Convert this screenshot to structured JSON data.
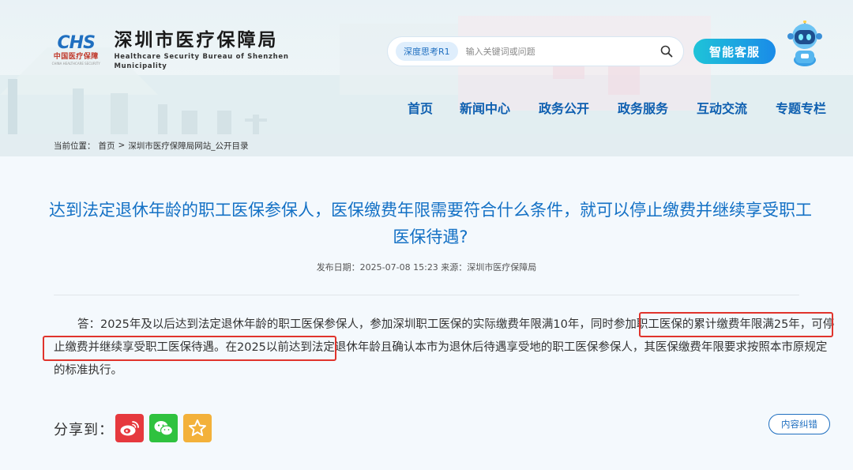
{
  "header": {
    "logo_mark": "CHS",
    "logo_mark_cn": "中国医疗保障",
    "logo_mark_en": "CHINA HEALTHCARE SECURITY",
    "title_cn": "深圳市医疗保障局",
    "title_en": "Healthcare Security Bureau of Shenzhen Municipality"
  },
  "search": {
    "tag": "深度思考R1",
    "placeholder": "输入关键词或问题"
  },
  "service_button": "智能客服",
  "nav": [
    "首页",
    "新闻中心",
    "政务公开",
    "政务服务",
    "互动交流",
    "专题专栏"
  ],
  "breadcrumb": {
    "label": "当前位置：",
    "home": "首页",
    "sep": ">",
    "current": "深圳市医疗保障局网站_公开目录"
  },
  "article": {
    "title": "达到法定退休年龄的职工医保参保人，医保缴费年限需要符合什么条件，就可以停止缴费并继续享受职工医保待遇?",
    "meta": "发布日期：2025-07-08 15:23 来源：深圳市医疗保障局",
    "body_part1": "答：2025年及以后达到法定退休年龄的职工医保参保人，参加深圳职工医保的实际缴费年限满10年，",
    "body_highlight": "同时参加职工医保的累计缴费年限满25年，可停止缴费并继续享受职工医保待遇。",
    "body_part2": "在2025以前达到法定退休年龄且确认本市为退休后待遇享受地的职工医保参保人，其医保缴费年限要求按照本市原规定的标准执行。"
  },
  "share": {
    "label": "分享到：",
    "items": [
      "weibo-icon",
      "wechat-icon",
      "favorite-icon"
    ]
  },
  "correction_button": "内容纠错",
  "colors": {
    "title_blue": "#1471c5",
    "nav_blue": "#0e5fb0",
    "highlight_red": "#e0342c",
    "weibo_red": "#e6393e",
    "wechat_green": "#2fc23f",
    "favorite_orange": "#f3b13a"
  }
}
